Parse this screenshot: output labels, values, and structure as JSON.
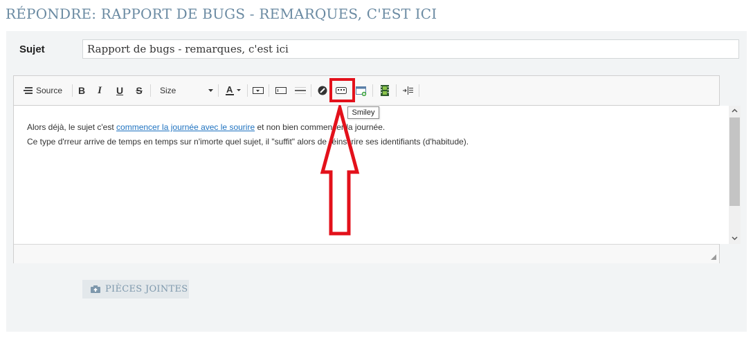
{
  "page_title": "RÉPONDRE: RAPPORT DE BUGS - REMARQUES, C'EST ICI",
  "subject": {
    "label": "Sujet",
    "value": "Rapport de bugs - remarques, c'est ici"
  },
  "toolbar": {
    "source_label": "Source",
    "size_label": "Size"
  },
  "editor_content": {
    "line1_before": "Alors déjà, le sujet c'est ",
    "line1_link": "commencer la journée avec le sourire",
    "line1_after": " et non bien commencer la journée.",
    "line2": "Ce type d'rreur arrive de temps en temps sur n'imorte quel sujet, il \"suffit\" alors de réinscrire ses identifiants (d'habitude)."
  },
  "tooltip": "Smiley",
  "attachments_label": "PIÈCES JOINTES",
  "colors": {
    "title": "#6a8aa2",
    "link": "#1e72c0",
    "annotation": "#e3111b",
    "panel_bg": "#f2f4f5"
  }
}
